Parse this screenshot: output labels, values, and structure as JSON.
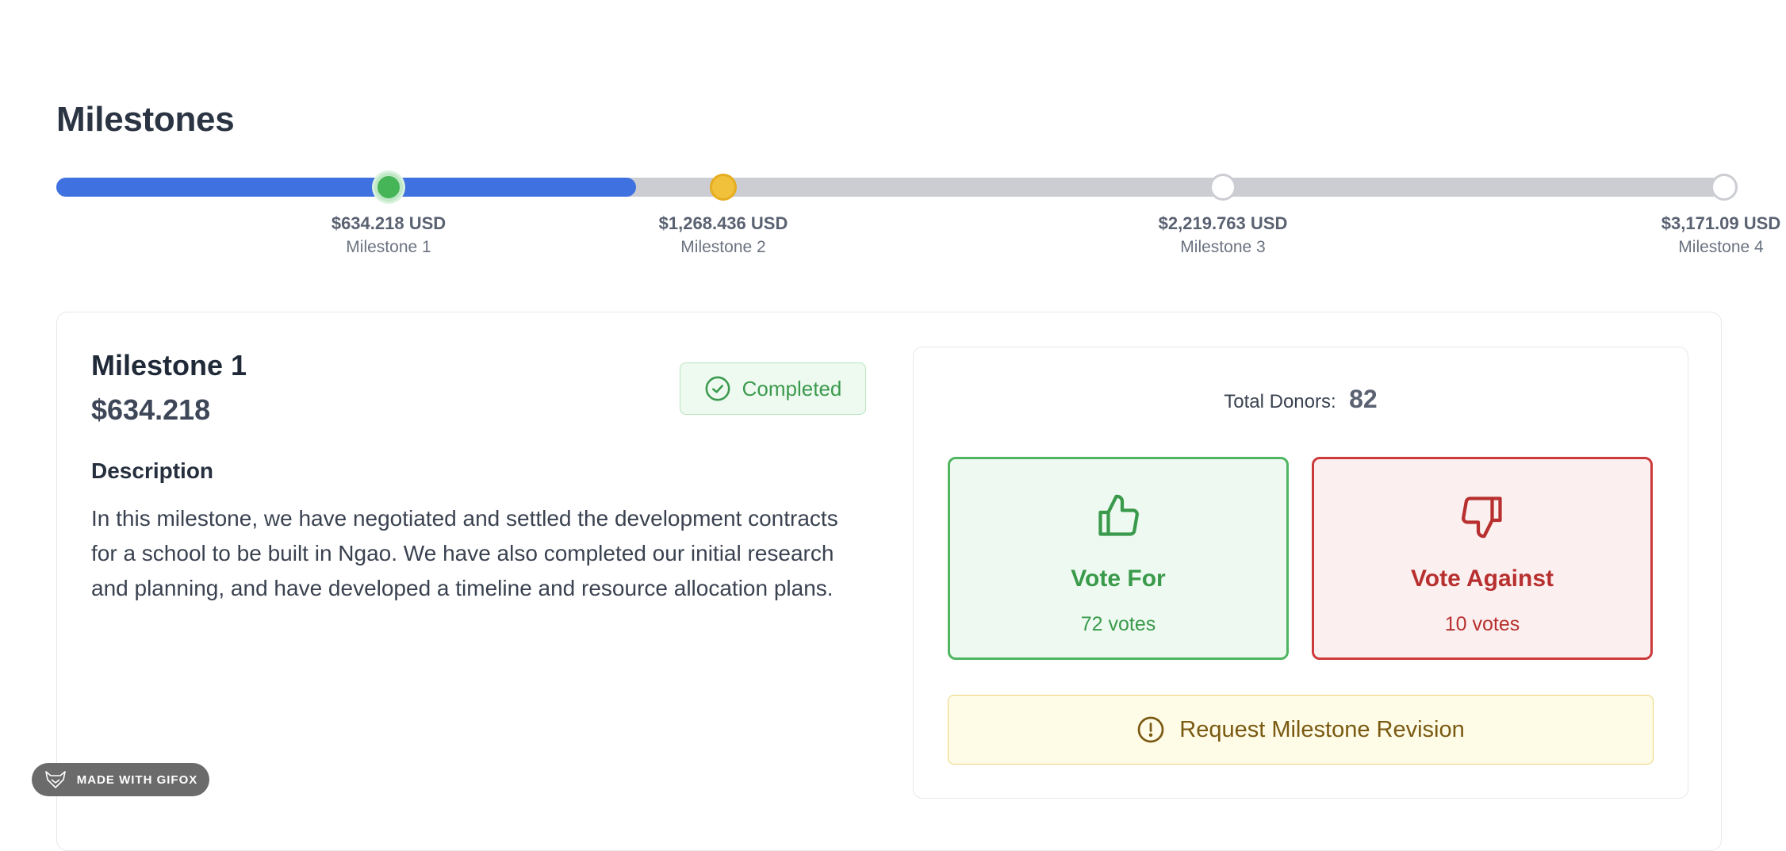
{
  "page": {
    "title": "Milestones"
  },
  "progress": {
    "filled_fraction": 0.345
  },
  "milestones": [
    {
      "amount_label": "$634.218 USD",
      "name": "Milestone 1",
      "state": "completed"
    },
    {
      "amount_label": "$1,268.436 USD",
      "name": "Milestone 2",
      "state": "active"
    },
    {
      "amount_label": "$2,219.763 USD",
      "name": "Milestone 3",
      "state": "pending"
    },
    {
      "amount_label": "$3,171.09 USD",
      "name": "Milestone 4",
      "state": "pending"
    }
  ],
  "detail": {
    "title": "Milestone 1",
    "amount": "$634.218",
    "status": "Completed",
    "status_icon": "check-circle-icon",
    "description_heading": "Description",
    "description": "In this milestone, we have negotiated and settled the development contracts for a school to be built in Ngao. We have also completed our initial research and planning, and have developed a timeline and resource allocation plans."
  },
  "voting": {
    "donors_label": "Total Donors:",
    "donors_count": "82",
    "for": {
      "label": "Vote For",
      "votes": "72 votes",
      "icon": "thumbs-up-icon",
      "color": "#3a9a4b"
    },
    "against": {
      "label": "Vote Against",
      "votes": "10 votes",
      "icon": "thumbs-down-icon",
      "color": "#b7302f"
    },
    "revision": {
      "label": "Request Milestone Revision",
      "icon": "alert-circle-icon"
    }
  },
  "watermark": {
    "text": "MADE WITH GIFOX",
    "icon": "fox-logo-icon"
  }
}
